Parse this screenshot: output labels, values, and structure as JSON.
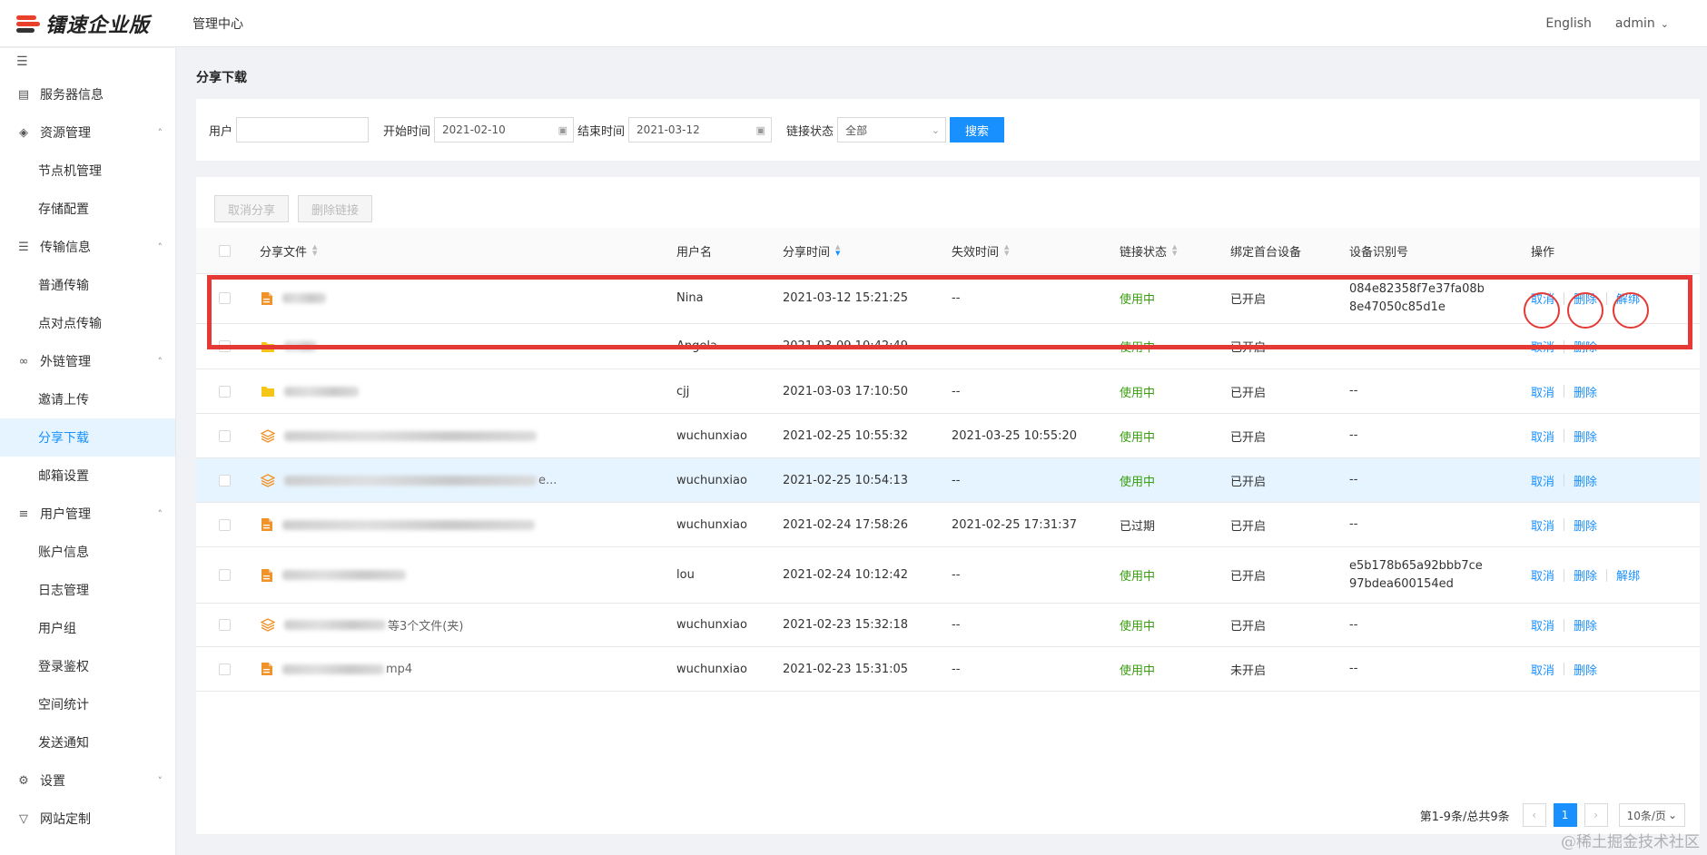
{
  "header": {
    "brand": "镭速企业版",
    "title": "管理中心",
    "language": "English",
    "user": "admin"
  },
  "sidebar": {
    "items": [
      {
        "label": "服务器信息",
        "icon": "server-icon",
        "arrow": ""
      },
      {
        "label": "资源管理",
        "icon": "layers-icon",
        "arrow": "^",
        "children": [
          "节点机管理",
          "存储配置"
        ]
      },
      {
        "label": "传输信息",
        "icon": "list-icon",
        "arrow": "^",
        "children": [
          "普通传输",
          "点对点传输"
        ]
      },
      {
        "label": "外链管理",
        "icon": "link-icon",
        "arrow": "^",
        "children": [
          "邀请上传",
          "分享下载",
          "邮箱设置"
        ]
      },
      {
        "label": "用户管理",
        "icon": "users-icon",
        "arrow": "^",
        "children": [
          "账户信息",
          "日志管理",
          "用户组",
          "登录鉴权",
          "空间统计",
          "发送通知"
        ]
      },
      {
        "label": "设置",
        "icon": "gear-icon",
        "arrow": "v"
      },
      {
        "label": "网站定制",
        "icon": "shirt-icon",
        "arrow": ""
      }
    ],
    "active": "分享下载"
  },
  "page": {
    "title": "分享下载"
  },
  "filter": {
    "user_label": "用户",
    "user_value": "",
    "start_label": "开始时间",
    "start_value": "2021-02-10",
    "end_label": "结束时间",
    "end_value": "2021-03-12",
    "status_label": "链接状态",
    "status_value": "全部",
    "search_label": "搜索"
  },
  "bulk": {
    "cancel_share": "取消分享",
    "delete_link": "删除链接"
  },
  "table": {
    "columns": [
      "分享文件",
      "用户名",
      "分享时间",
      "失效时间",
      "链接状态",
      "绑定首台设备",
      "设备识别号",
      "操作"
    ],
    "rows": [
      {
        "icon": "document-icon",
        "file_suffix": "",
        "user": "Nina",
        "share_time": "2021-03-12 15:21:25",
        "expire": "--",
        "status": "使用中",
        "bind": "已开启",
        "device": [
          "084e82358f7e37fa08b",
          "8e47050c85d1e"
        ],
        "actions": [
          "取消",
          "删除",
          "解绑"
        ]
      },
      {
        "icon": "folder-icon",
        "file_suffix": "",
        "user": "Angela",
        "share_time": "2021-03-09 10:42:49",
        "expire": "--",
        "status": "使用中",
        "bind": "已开启",
        "device": [
          "--"
        ],
        "actions": [
          "取消",
          "删除"
        ]
      },
      {
        "icon": "folder-icon",
        "file_suffix": "",
        "user": "cjj",
        "share_time": "2021-03-03 17:10:50",
        "expire": "--",
        "status": "使用中",
        "bind": "已开启",
        "device": [
          "--"
        ],
        "actions": [
          "取消",
          "删除"
        ]
      },
      {
        "icon": "layers-icon",
        "file_suffix": "",
        "user": "wuchunxiao",
        "share_time": "2021-02-25 10:55:32",
        "expire": "2021-03-25 10:55:20",
        "status": "使用中",
        "bind": "已开启",
        "device": [
          "--"
        ],
        "actions": [
          "取消",
          "删除"
        ]
      },
      {
        "icon": "layers-icon",
        "file_suffix": "e...",
        "user": "wuchunxiao",
        "share_time": "2021-02-25 10:54:13",
        "expire": "--",
        "status": "使用中",
        "bind": "已开启",
        "device": [
          "--"
        ],
        "actions": [
          "取消",
          "删除"
        ]
      },
      {
        "icon": "document-icon",
        "file_suffix": "",
        "user": "wuchunxiao",
        "share_time": "2021-02-24 17:58:26",
        "expire": "2021-02-25 17:31:37",
        "status": "已过期",
        "bind": "已开启",
        "device": [
          "--"
        ],
        "actions": [
          "取消",
          "删除"
        ]
      },
      {
        "icon": "document-icon",
        "file_suffix": "",
        "user": "lou",
        "share_time": "2021-02-24 10:12:42",
        "expire": "--",
        "status": "使用中",
        "bind": "已开启",
        "device": [
          "e5b178b65a92bbb7ce",
          "97bdea600154ed"
        ],
        "actions": [
          "取消",
          "删除",
          "解绑"
        ]
      },
      {
        "icon": "layers-icon",
        "file_suffix": "等3个文件(夹)",
        "user": "wuchunxiao",
        "share_time": "2021-02-23 15:32:18",
        "expire": "--",
        "status": "使用中",
        "bind": "已开启",
        "device": [
          "--"
        ],
        "actions": [
          "取消",
          "删除"
        ]
      },
      {
        "icon": "document-icon",
        "file_suffix": "mp4",
        "user": "wuchunxiao",
        "share_time": "2021-02-23 15:31:05",
        "expire": "--",
        "status": "使用中",
        "bind": "未开启",
        "device": [
          "--"
        ],
        "actions": [
          "取消",
          "删除"
        ]
      }
    ]
  },
  "pagination": {
    "summary": "第1-9条/总共9条",
    "current": "1",
    "page_size": "10条/页"
  },
  "watermark": "@稀土掘金技术社区",
  "colors": {
    "accent": "#1890ff",
    "status_ok": "#389e0d",
    "highlight": "#e53935",
    "doc_icon": "#f0932b",
    "folder_icon": "#f5c518"
  }
}
